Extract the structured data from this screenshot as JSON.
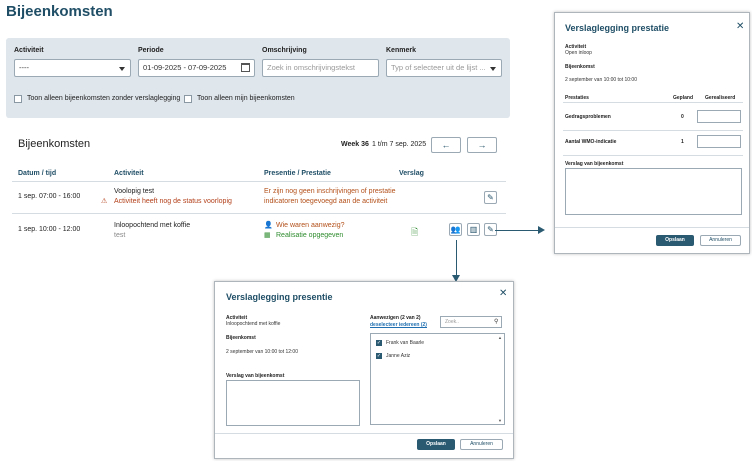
{
  "page": {
    "title": "Bijeenkomsten"
  },
  "filters": {
    "activiteit": {
      "label": "Activiteit",
      "value": "----"
    },
    "periode": {
      "label": "Periode",
      "value": "01-09-2025 - 07-09-2025"
    },
    "omschrijving": {
      "label": "Omschrijving",
      "placeholder": "Zoek in omschrijvingstekst"
    },
    "kenmerk": {
      "label": "Kenmerk",
      "placeholder": "Typ of selecteer uit de lijst ..."
    },
    "check_zonder_verslag": "Toon alleen bijeenkomsten zonder verslaglegging",
    "check_mijn": "Toon alleen mijn bijeenkomsten"
  },
  "list": {
    "title": "Bijeenkomsten",
    "week": "Week 36",
    "range": "1 t/m 7 sep. 2025",
    "prev": "←",
    "next": "→",
    "columns": [
      "Datum / tijd",
      "Activiteit",
      "Presentie / Prestatie",
      "Verslag"
    ],
    "rows": [
      {
        "datetime": "1 sep. 07:00 - 16:00",
        "activity": "Voolopig test",
        "activity_warning": "Activiteit heeft nog de status voorlopig",
        "presentie_line1": "Er zijn nog geen inschrijvingen of prestatie",
        "presentie_line2": "indicatoren toegevoegd aan de activiteit"
      },
      {
        "datetime": "1 sep. 10:00 - 12:00",
        "activity": "Inloopochtend met koffie",
        "activity_sub": "test",
        "presentie_line1": "Wie waren aanwezig?",
        "presentie_line2": "Realisatie opgegeven"
      }
    ]
  },
  "modal_prestatie": {
    "title": "Verslaglegging prestatie",
    "activiteit_label": "Activiteit",
    "activiteit_value": "Open inloop",
    "bijeenkomst_label": "Bijeenkomst",
    "bijeenkomst_value": "2 september van 10:00 tot 10:00",
    "col_prestaties": "Prestaties",
    "col_gepland": "Gepland",
    "col_gerealiseerd": "Gerealiseerd",
    "rows": [
      {
        "name": "Gedragsproblemen",
        "gepland": "0"
      },
      {
        "name": "Aantal WMO-indicatie",
        "gepland": "1"
      }
    ],
    "verslag_label": "Verslag van bijeenkomst",
    "save": "Opslaan",
    "cancel": "Annuleren"
  },
  "modal_presentie": {
    "title": "Verslaglegging presentie",
    "activiteit_label": "Activiteit",
    "activiteit_value": "Inloopochtend met koffie",
    "bijeenkomst_label": "Bijeenkomst",
    "bijeenkomst_value": "2 september van 10:00 tot 12:00",
    "verslag_label": "Verslag van bijeenkomst",
    "aanwezigen_label": "Aanwezigen (2 van 2)",
    "deselect_link": "deselecteer iedereen (2)",
    "search_placeholder": "Zoek..",
    "people": [
      "Frank van Baarle",
      "Janne Aziz"
    ],
    "save": "Opslaan",
    "cancel": "Annuleren"
  },
  "colors": {
    "brand": "#1f4e66",
    "primary_button": "#2a5a72",
    "filter_panel": "#dfe6ec",
    "warning": "#b3401a",
    "success": "#2e8b2e"
  }
}
